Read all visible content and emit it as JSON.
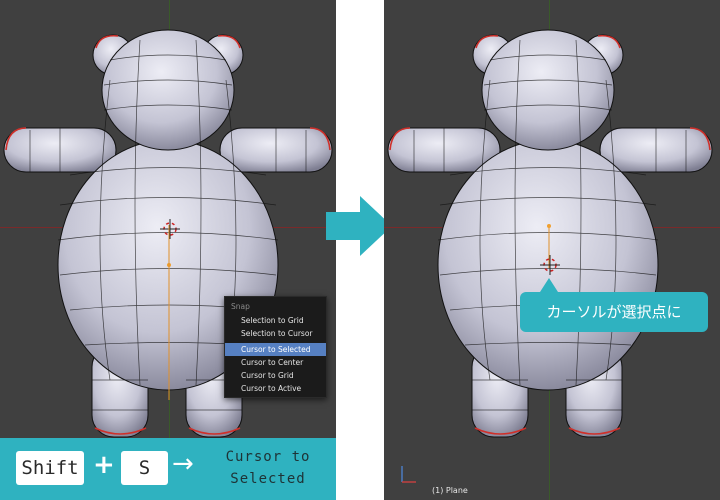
{
  "snap_menu": {
    "title": "Snap",
    "items": [
      "Selection to Grid",
      "Selection to Cursor",
      "Cursor to Selected",
      "Cursor to Center",
      "Cursor to Grid",
      "Cursor to Active"
    ],
    "active_item": "Cursor to Selected"
  },
  "shortcut": {
    "key1": "Shift",
    "plus": "+",
    "key2": "S",
    "arrow": "→",
    "action_line1": "Cursor to",
    "action_line2": "Selected"
  },
  "callout": {
    "text": "カーソルが選択点に"
  },
  "status": {
    "object_label": "(1) Plane"
  },
  "colors": {
    "accent": "#2fb2c0",
    "viewport_bg": "#404040",
    "menu_bg": "#1b1b1b",
    "menu_highlight": "#5680c2",
    "mesh_fill": "#c8c8d6",
    "selection_edge": "#d0302a"
  },
  "icons": {
    "transition": "right-arrow-icon",
    "cursor": "3d-cursor-icon",
    "axes": "axis-gizmo-icon"
  }
}
